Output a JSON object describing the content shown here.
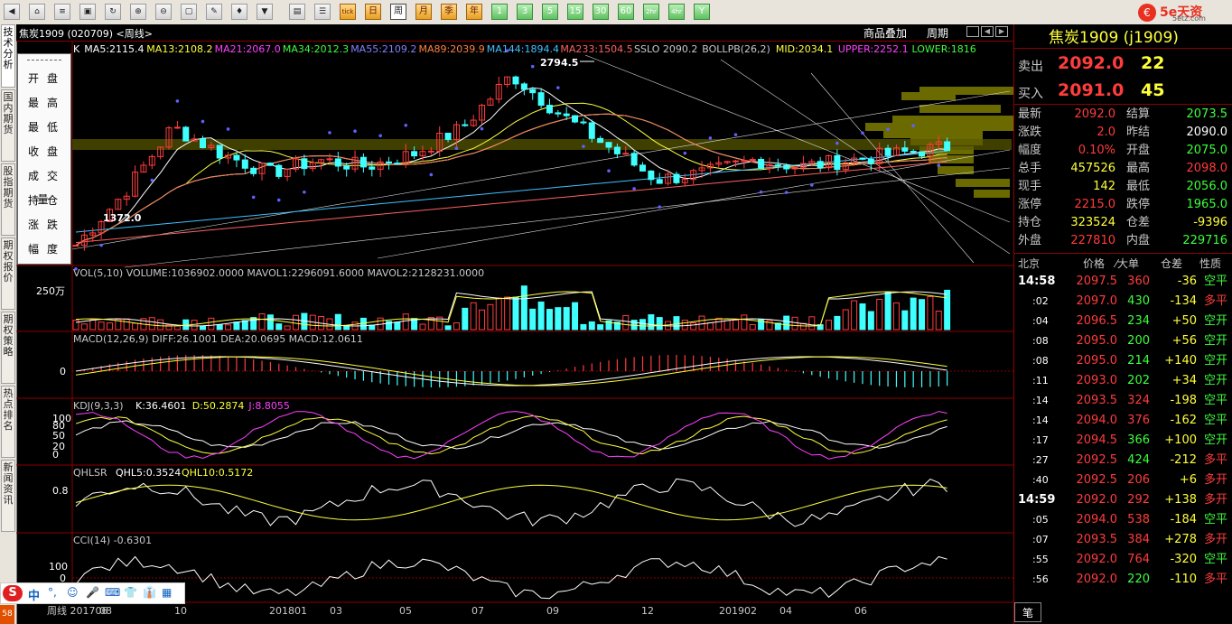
{
  "toolbar": {
    "periods": [
      "日",
      "周",
      "月",
      "季",
      "年"
    ],
    "active_period": "周",
    "minutes": [
      "1",
      "3",
      "5",
      "15",
      "30",
      "60",
      "2hr",
      "4hr",
      "Y"
    ],
    "tick_label": "tick"
  },
  "logo": {
    "brand": "5e天资",
    "sub": "5etz.com"
  },
  "left_tabs": [
    "技术分析",
    "国内期货",
    "股指期货",
    "期权报价",
    "期权策略",
    "热点排名",
    "新闻资讯"
  ],
  "chart": {
    "title": "焦炭1909 (020709) <周线>",
    "overlay_btn": "商品叠加",
    "period_btn": "周期",
    "ma_line": [
      {
        "t": "K",
        "c": "#ffffff"
      },
      {
        "t": "MA5:2115.4",
        "c": "#ffffff"
      },
      {
        "t": "MA13:2108.2",
        "c": "#ffff3c"
      },
      {
        "t": "MA21:2067.0",
        "c": "#ff40ff"
      },
      {
        "t": "MA34:2012.3",
        "c": "#3cff3c"
      },
      {
        "t": "MA55:2109.2",
        "c": "#8080ff"
      },
      {
        "t": "MA89:2039.9",
        "c": "#ff8040"
      },
      {
        "t": "MA144:1894.4",
        "c": "#40c0ff"
      },
      {
        "t": "MA233:1504.5",
        "c": "#ff6060"
      },
      {
        "t": "SSLO 2090.2",
        "c": "#c8c8c8"
      },
      {
        "t": "BOLLPB(26,2)",
        "c": "#c8c8c8"
      },
      {
        "t": "MID:2034.1",
        "c": "#ffff3c"
      },
      {
        "t": "UPPER:2252.1",
        "c": "#ff40ff"
      },
      {
        "t": "LOWER:1816",
        "c": "#3cff3c"
      }
    ],
    "high_label": "2794.5",
    "low_label": "1372.0",
    "vol_title": "VOL(5,10) VOLUME:1036902.0000 MAVOL1:2296091.6000 MAVOL2:2128231.0000",
    "vol_axis": "250万",
    "macd_title": "MACD(12,26,9) DIFF:26.1001 DEA:20.0695 MACD:12.0611",
    "macd_axis": "0",
    "kdj_prefix": "KDJ(9,3,3)",
    "kdj_k": "K:36.4601",
    "kdj_d": "D:50.2874",
    "kdj_j": "J:8.8055",
    "kdj_axis": [
      "100",
      "80",
      "50",
      "20",
      "0"
    ],
    "qhl_prefix": "QHLSR",
    "qhl5": "QHL5:0.3524",
    "qhl10": "QHL10:0.5172",
    "qhl_axis": "0.8",
    "cci_title": "CCI(14) -0.6301",
    "cci_axis": [
      "100",
      "0"
    ],
    "x_labels": [
      "周线 201706",
      "08",
      "10",
      "201801",
      "03",
      "05",
      "07",
      "09",
      "12",
      "201902",
      "04",
      "06"
    ]
  },
  "kline_menu": [
    "开盘",
    "最高",
    "最低",
    "收盘",
    "成交量",
    "持仓",
    "涨跌",
    "幅度"
  ],
  "quote": {
    "name": "焦炭1909 (j1909)",
    "sell_label": "卖出",
    "sell_price": "2092.0",
    "sell_vol": "22",
    "buy_label": "买入",
    "buy_price": "2091.0",
    "buy_vol": "45",
    "rows": [
      {
        "l1": "最新",
        "v1": "2092.0",
        "c1": "red",
        "l2": "结算",
        "v2": "2073.5",
        "c2": "green"
      },
      {
        "l1": "涨跌",
        "v1": "2.0",
        "c1": "red",
        "l2": "昨结",
        "v2": "2090.0",
        "c2": "white"
      },
      {
        "l1": "幅度",
        "v1": "0.10%",
        "c1": "red",
        "l2": "开盘",
        "v2": "2075.0",
        "c2": "green"
      },
      {
        "l1": "总手",
        "v1": "457526",
        "c1": "yellow",
        "l2": "最高",
        "v2": "2098.0",
        "c2": "red"
      },
      {
        "l1": "现手",
        "v1": "142",
        "c1": "yellow",
        "l2": "最低",
        "v2": "2056.0",
        "c2": "green"
      },
      {
        "l1": "涨停",
        "v1": "2215.0",
        "c1": "red",
        "l2": "跌停",
        "v2": "1965.0",
        "c2": "green"
      },
      {
        "l1": "持仓",
        "v1": "323524",
        "c1": "yellow",
        "l2": "仓差",
        "v2": "-9396",
        "c2": "yellow"
      },
      {
        "l1": "外盘",
        "v1": "227810",
        "c1": "red",
        "l2": "内盘",
        "v2": "229716",
        "c2": "green"
      }
    ],
    "tick_headers": [
      "北京",
      "价格",
      "⁄大单",
      "仓差",
      "性质"
    ],
    "ticks": [
      {
        "t": "14:58",
        "p": "2097.5",
        "v": "360",
        "d": "-36",
        "n": "空平",
        "pc": "red",
        "vc": "red",
        "dc": "yellow",
        "nc": "green"
      },
      {
        "t": ":02",
        "p": "2097.0",
        "v": "430",
        "d": "-134",
        "n": "多平",
        "pc": "red",
        "vc": "green",
        "dc": "yellow",
        "nc": "red"
      },
      {
        "t": ":04",
        "p": "2096.5",
        "v": "234",
        "d": "+50",
        "n": "空开",
        "pc": "red",
        "vc": "green",
        "dc": "yellow",
        "nc": "green"
      },
      {
        "t": ":08",
        "p": "2095.0",
        "v": "200",
        "d": "+56",
        "n": "空开",
        "pc": "red",
        "vc": "green",
        "dc": "yellow",
        "nc": "green"
      },
      {
        "t": ":08",
        "p": "2095.0",
        "v": "214",
        "d": "+140",
        "n": "空开",
        "pc": "red",
        "vc": "green",
        "dc": "yellow",
        "nc": "green"
      },
      {
        "t": ":11",
        "p": "2093.0",
        "v": "202",
        "d": "+34",
        "n": "空开",
        "pc": "red",
        "vc": "green",
        "dc": "yellow",
        "nc": "green"
      },
      {
        "t": ":14",
        "p": "2093.5",
        "v": "324",
        "d": "-198",
        "n": "空平",
        "pc": "red",
        "vc": "red",
        "dc": "yellow",
        "nc": "green"
      },
      {
        "t": ":14",
        "p": "2094.0",
        "v": "376",
        "d": "-162",
        "n": "空平",
        "pc": "red",
        "vc": "red",
        "dc": "yellow",
        "nc": "green"
      },
      {
        "t": ":17",
        "p": "2094.5",
        "v": "366",
        "d": "+100",
        "n": "空开",
        "pc": "red",
        "vc": "green",
        "dc": "yellow",
        "nc": "green"
      },
      {
        "t": ":27",
        "p": "2092.5",
        "v": "424",
        "d": "-212",
        "n": "多平",
        "pc": "red",
        "vc": "green",
        "dc": "yellow",
        "nc": "red"
      },
      {
        "t": ":40",
        "p": "2092.5",
        "v": "206",
        "d": "+6",
        "n": "多开",
        "pc": "red",
        "vc": "red",
        "dc": "yellow",
        "nc": "red"
      },
      {
        "t": "14:59",
        "p": "2092.0",
        "v": "292",
        "d": "+138",
        "n": "多开",
        "pc": "red",
        "vc": "red",
        "dc": "yellow",
        "nc": "red"
      },
      {
        "t": ":05",
        "p": "2094.0",
        "v": "538",
        "d": "-184",
        "n": "空平",
        "pc": "red",
        "vc": "red",
        "dc": "yellow",
        "nc": "green"
      },
      {
        "t": ":07",
        "p": "2093.5",
        "v": "384",
        "d": "+278",
        "n": "多开",
        "pc": "red",
        "vc": "red",
        "dc": "yellow",
        "nc": "red"
      },
      {
        "t": ":55",
        "p": "2092.0",
        "v": "764",
        "d": "-320",
        "n": "空平",
        "pc": "red",
        "vc": "red",
        "dc": "yellow",
        "nc": "green"
      },
      {
        "t": ":56",
        "p": "2092.0",
        "v": "220",
        "d": "-110",
        "n": "多平",
        "pc": "red",
        "vc": "green",
        "dc": "yellow",
        "nc": "red"
      }
    ],
    "footer_tab": "笔"
  },
  "ime": {
    "label": "中",
    "items": [
      "°,",
      "☺",
      "🎤",
      "⌨",
      "👕",
      "👔",
      "▦"
    ]
  },
  "colors": {
    "up": "#ff3c3c",
    "down": "#40ffff",
    "grid": "#8b0000",
    "bg": "#000000"
  }
}
